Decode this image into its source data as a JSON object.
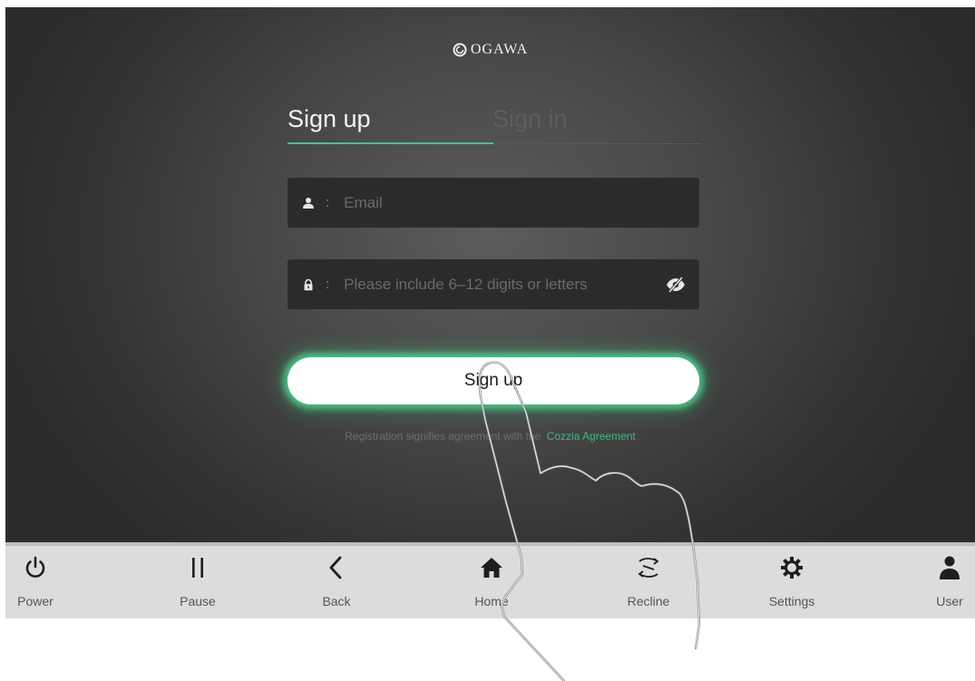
{
  "app": {
    "brand": "OGAWA",
    "accent_color": "#46c38b"
  },
  "tabs": [
    {
      "label": "Sign up",
      "active": true
    },
    {
      "label": "Sign in",
      "active": false
    }
  ],
  "form": {
    "email": {
      "icon": "user-icon",
      "separator": ":",
      "placeholder": "Email",
      "value": ""
    },
    "password": {
      "icon": "lock-icon",
      "separator": ":",
      "placeholder": "Please include 6–12 digits or letters",
      "value": "",
      "toggle_icon": "eye-slash-icon"
    },
    "submit_label": "Sign up",
    "agreement_text": "Registration signifies agreement with the",
    "agreement_link": "Cozzia Agreement"
  },
  "bottom_nav": [
    {
      "label": "Power",
      "icon": "power-icon"
    },
    {
      "label": "Pause",
      "icon": "pause-icon"
    },
    {
      "label": "Back",
      "icon": "back-icon"
    },
    {
      "label": "Home",
      "icon": "home-icon"
    },
    {
      "label": "Recline",
      "icon": "recline-icon"
    },
    {
      "label": "Settings",
      "icon": "gear-icon"
    },
    {
      "label": "User",
      "icon": "user-icon"
    }
  ]
}
